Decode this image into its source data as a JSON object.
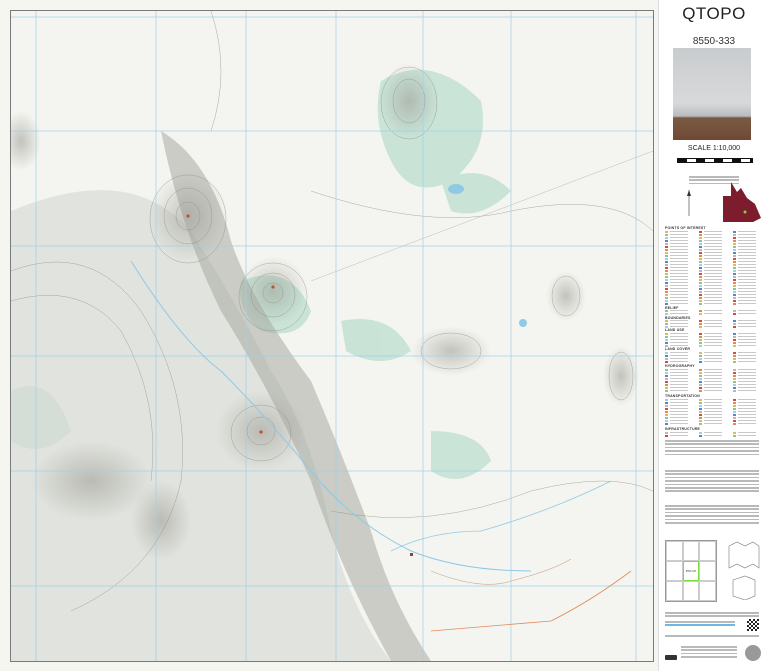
{
  "header": {
    "title": "QTOPO",
    "sheet_number": "8550-333"
  },
  "scale": {
    "label": "SCALE 1:10,000"
  },
  "legend": {
    "sections": [
      "POINTS OF INTEREST",
      "RELIEF",
      "BOUNDARIES",
      "LAND USE",
      "LAND COVER",
      "HYDROGRAPHY",
      "TRANSPORTATION",
      "INFRASTRUCTURE"
    ]
  },
  "index": {
    "current_sheet": "8550-333"
  },
  "colors": {
    "map_background": "#f4f5f0",
    "vegetation": "#bfe0d2",
    "water": "#8fc9e6",
    "grid": "#9fd0e8",
    "contour": "#8a8a80",
    "queensland": "#7d1c2c",
    "road": "#e08a5a",
    "current_sheet_highlight": "#7bdc3b"
  },
  "icons": [
    "peak-marker-icon",
    "homestead-icon",
    "north-arrow-icon",
    "queensland-locator-map",
    "qr-code-icon",
    "creative-commons-icon",
    "queensland-crest-icon"
  ]
}
